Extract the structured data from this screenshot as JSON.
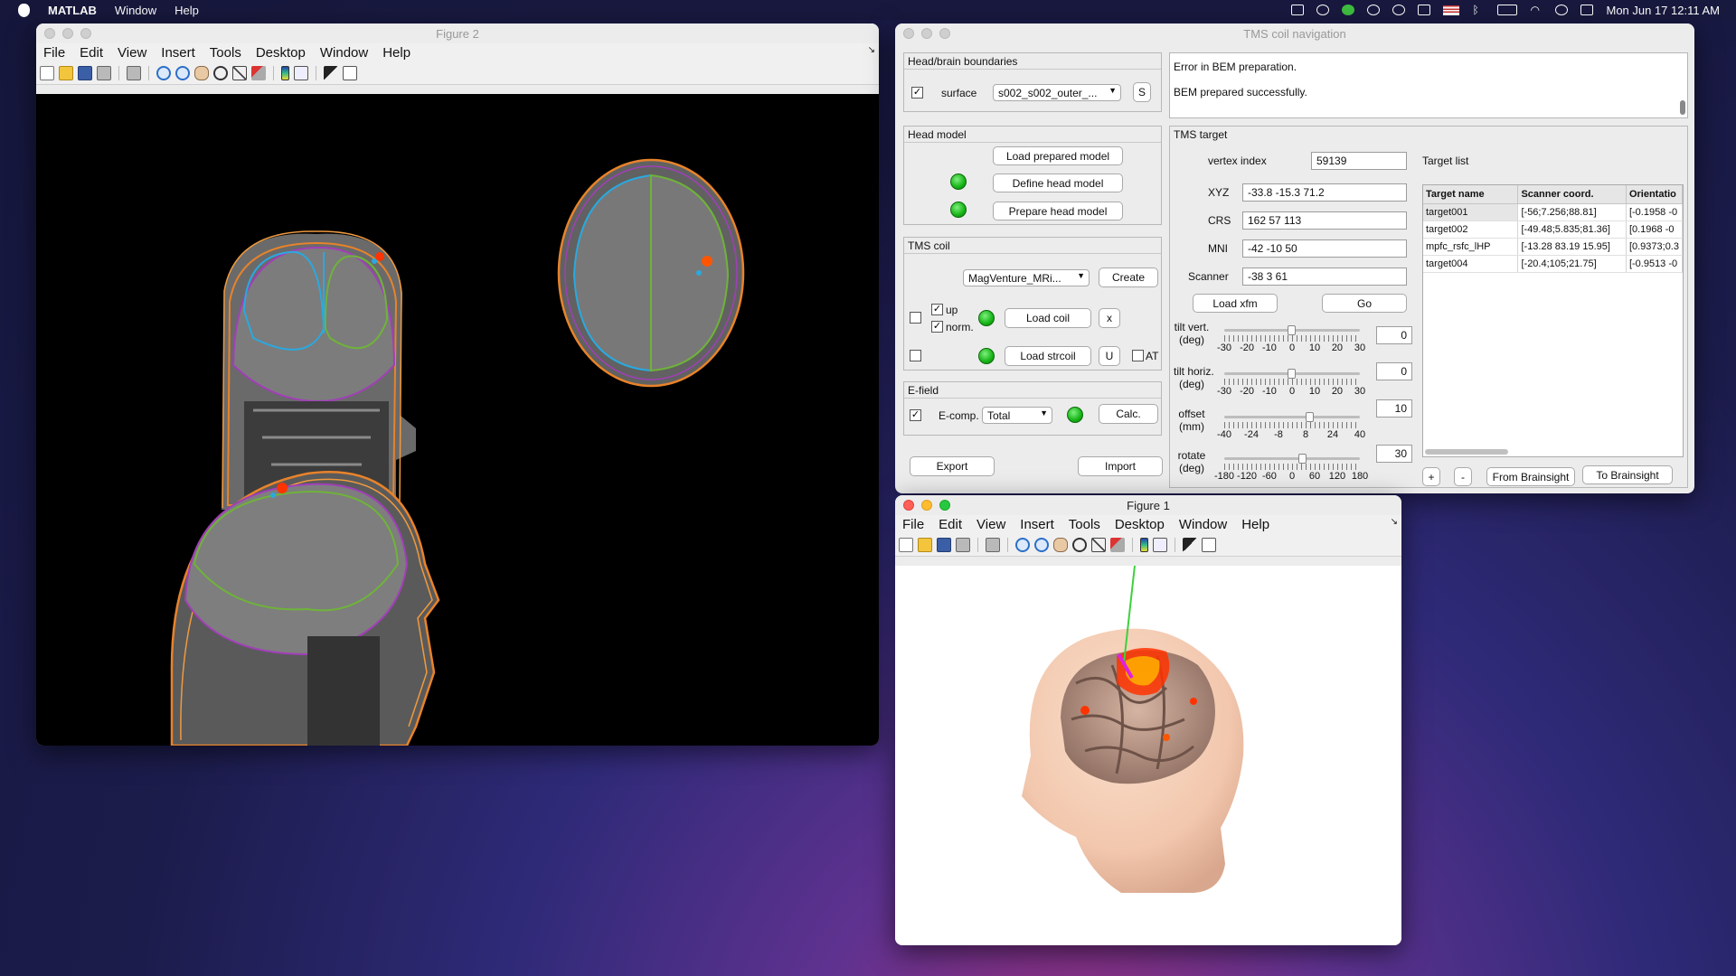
{
  "menubar": {
    "app": "MATLAB",
    "items": [
      "Window",
      "Help"
    ],
    "clock": "Mon Jun 17  12:11 AM"
  },
  "figure_menu": [
    "File",
    "Edit",
    "View",
    "Insert",
    "Tools",
    "Desktop",
    "Window",
    "Help"
  ],
  "toolbar_icons": [
    "new-file-icon",
    "open-folder-icon",
    "save-icon",
    "print-icon",
    "print-preview-icon",
    "zoom-in-icon",
    "zoom-out-icon",
    "pan-icon",
    "rotate-icon",
    "data-cursor-icon",
    "brush-icon",
    "colorbar-icon",
    "legend-icon",
    "pointer-icon",
    "property-inspector-icon"
  ],
  "figure2": {
    "title": "Figure 2"
  },
  "figure1": {
    "title": "Figure 1"
  },
  "nav": {
    "title": "TMS coil navigation",
    "head_boundaries": {
      "title": "Head/brain boundaries",
      "surface_label": "surface",
      "surface_checked": true,
      "surface_value": "s002_s002_outer_...",
      "s_button": "S"
    },
    "log": [
      "Error in BEM preparation.",
      "BEM prepared successfully."
    ],
    "head_model": {
      "title": "Head model",
      "load": "Load prepared model",
      "define": "Define head model",
      "prepare": "Prepare head model"
    },
    "coil": {
      "title": "TMS coil",
      "select": "MagVenture_MRi...",
      "create": "Create",
      "up": "up",
      "norm": "norm.",
      "load_coil": "Load coil",
      "x_button": "x",
      "load_strcoil": "Load strcoil",
      "u_button": "U",
      "at": "AT"
    },
    "efield": {
      "title": "E-field",
      "ecomp": "E-comp.",
      "ecomp_value": "Total",
      "calc": "Calc."
    },
    "export": "Export",
    "import": "Import",
    "target": {
      "title": "TMS target",
      "vertex_label": "vertex index",
      "vertex_value": "59139",
      "xyz_label": "XYZ",
      "xyz_value": "-33.8 -15.3  71.2",
      "crs_label": "CRS",
      "crs_value": "162  57 113",
      "mni_label": "MNI",
      "mni_value": "-42 -10  50",
      "scanner_label": "Scanner",
      "scanner_value": "-38  3  61",
      "load_xfm": "Load xfm",
      "go": "Go",
      "tilt_vert_label": "tilt vert.\n(deg)",
      "tilt_vert_value": "0",
      "tilt_vert_ticks": [
        "-30",
        "-20",
        "-10",
        "0",
        "10",
        "20",
        "30"
      ],
      "tilt_horiz_label": "tilt horiz.\n(deg)",
      "tilt_horiz_value": "0",
      "tilt_horiz_ticks": [
        "-30",
        "-20",
        "-10",
        "0",
        "10",
        "20",
        "30"
      ],
      "offset_label": "offset\n(mm)",
      "offset_value": "10",
      "offset_ticks": [
        "-40",
        "-24",
        "-8",
        "8",
        "24",
        "40"
      ],
      "rotate_label": "rotate\n(deg)",
      "rotate_value": "30",
      "rotate_ticks": [
        "-180",
        "-120",
        "-60",
        "0",
        "60",
        "120",
        "180"
      ]
    },
    "target_list": {
      "label": "Target list",
      "columns": [
        "Target name",
        "Scanner coord.",
        "Orientatio"
      ],
      "rows": [
        [
          "target001",
          "[-56;7.256;88.81]",
          "[-0.1958 -0"
        ],
        [
          "target002",
          "[-49.48;5.835;81.36]",
          "[0.1968 -0"
        ],
        [
          "mpfc_rsfc_lHP",
          "[-13.28 83.19 15.95]",
          "[0.9373;0.3"
        ],
        [
          "target004",
          "[-20.4;105;21.75]",
          "[-0.9513 -0"
        ]
      ],
      "plus": "+",
      "minus": "-",
      "from_brainsight": "From Brainsight",
      "to_brainsight": "To Brainsight"
    }
  },
  "colors": {
    "status_green": "#15b315",
    "head_surface": "#f2c7ad",
    "brain_surface": "#c9a596",
    "efield_hot": "#ff3300",
    "contour_outer": "#e8832a",
    "contour_skull": "#a13fb8",
    "contour_gm": "#6fb33a",
    "contour_wm": "#2aa9e0"
  }
}
